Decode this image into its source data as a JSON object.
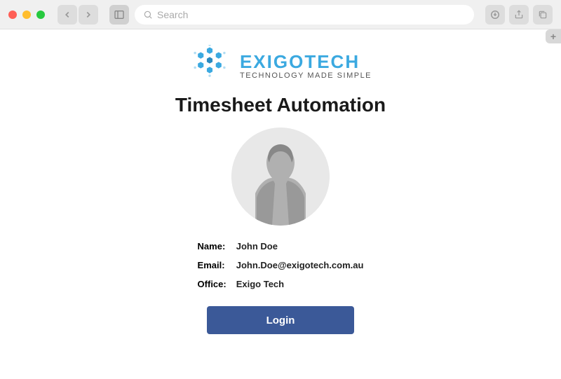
{
  "browser": {
    "search_placeholder": "Search",
    "tab_plus": "+"
  },
  "brand": {
    "name": "EXIGOTECH",
    "tagline": "TECHNOLOGY MADE SIMPLE"
  },
  "app": {
    "title": "Timesheet Automation"
  },
  "user": {
    "labels": {
      "name": "Name:",
      "email": "Email:",
      "office": "Office:"
    },
    "name": "John Doe",
    "email": "John.Doe@exigotech.com.au",
    "office": "Exigo Tech"
  },
  "actions": {
    "login": "Login"
  },
  "colors": {
    "brand_blue": "#3ba9e0",
    "button_blue": "#3b5998"
  }
}
